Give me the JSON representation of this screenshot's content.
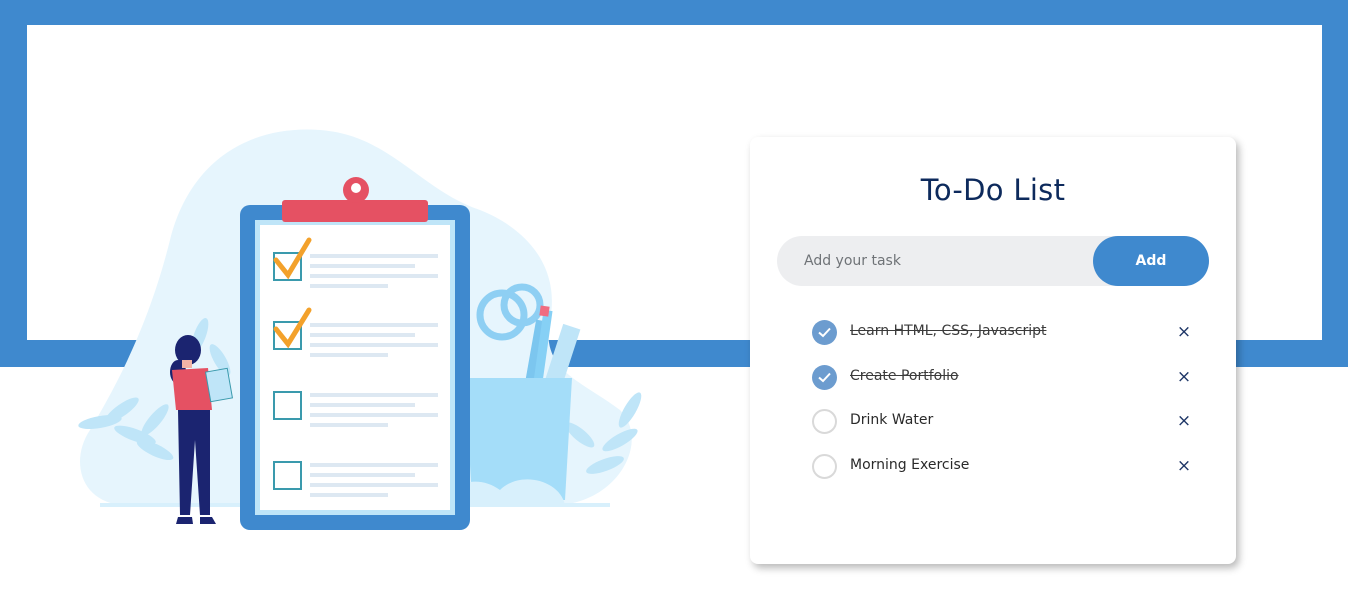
{
  "app": {
    "title": "To-Do List",
    "input": {
      "placeholder": "Add your task",
      "value": ""
    },
    "add_label": "Add",
    "tasks": [
      {
        "label": "Learn HTML, CSS, Javascript",
        "done": true
      },
      {
        "label": "Create Portfolio",
        "done": true
      },
      {
        "label": "Drink Water",
        "done": false
      },
      {
        "label": "Morning Exercise",
        "done": false
      }
    ],
    "delete_glyph": "×"
  },
  "colors": {
    "accent": "#3f89ce",
    "title": "#0d2a5c",
    "checked": "#6c9ccf",
    "input_bg": "#edeef0"
  },
  "icons": {
    "check": "check-icon",
    "delete": "close-icon"
  }
}
